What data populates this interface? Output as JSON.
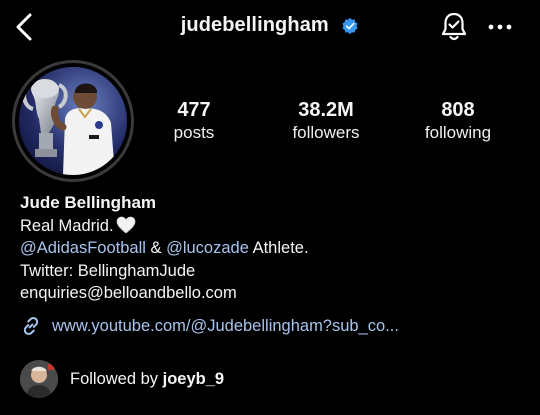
{
  "header": {
    "username": "judebellingham"
  },
  "stats": {
    "posts": {
      "value": "477",
      "label": "posts"
    },
    "followers": {
      "value": "38.2M",
      "label": "followers"
    },
    "following": {
      "value": "808",
      "label": "following"
    }
  },
  "bio": {
    "name": "Jude Bellingham",
    "line1": "Real Madrid.",
    "mention1": "@AdidasFootball",
    "amp": " & ",
    "mention2": "@lucozade",
    "athlete": " Athlete.",
    "twitter": "Twitter: BellinghamJude",
    "email": "enquiries@belloandbello.com"
  },
  "link": {
    "url": "www.youtube.com/@Judebellingham?sub_co..."
  },
  "followed_by": {
    "prefix": "Followed by ",
    "user": "joeyb_9"
  },
  "colors": {
    "background": "#000000",
    "link": "#a7c4ee",
    "verified": "#3897f0"
  },
  "icons": [
    "back-arrow-icon",
    "verified-badge-icon",
    "notification-bell-icon",
    "more-options-icon",
    "white-heart-icon",
    "link-chain-icon"
  ]
}
